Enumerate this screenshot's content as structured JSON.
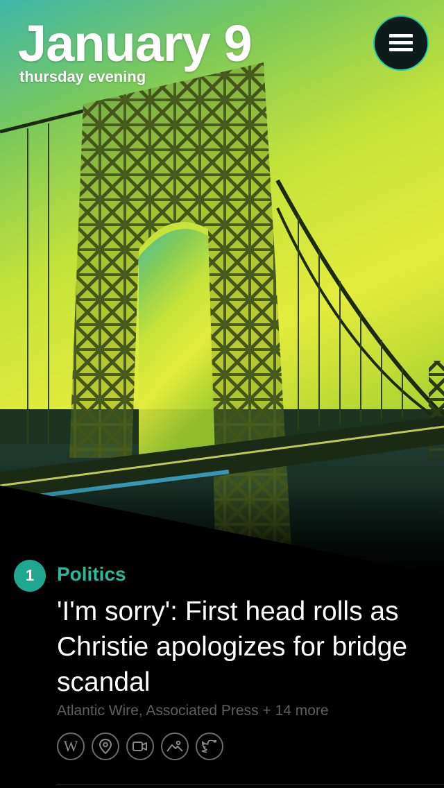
{
  "header": {
    "date": "January 9",
    "period": "thursday evening"
  },
  "menu": {
    "icon": "hamburger-icon"
  },
  "story": {
    "rank": "1",
    "category": "Politics",
    "headline": "'I'm sorry': First head rolls as Christie apologizes for bridge scandal",
    "sources": "Atlantic Wire, Associated Press + 14 more",
    "actions": [
      {
        "icon": "wikipedia-icon"
      },
      {
        "icon": "location-pin-icon"
      },
      {
        "icon": "video-icon"
      },
      {
        "icon": "image-icon"
      },
      {
        "icon": "twitter-icon"
      }
    ]
  },
  "colors": {
    "accent": "#2bb99b",
    "badge": "#1fa88f",
    "background": "#000000"
  }
}
